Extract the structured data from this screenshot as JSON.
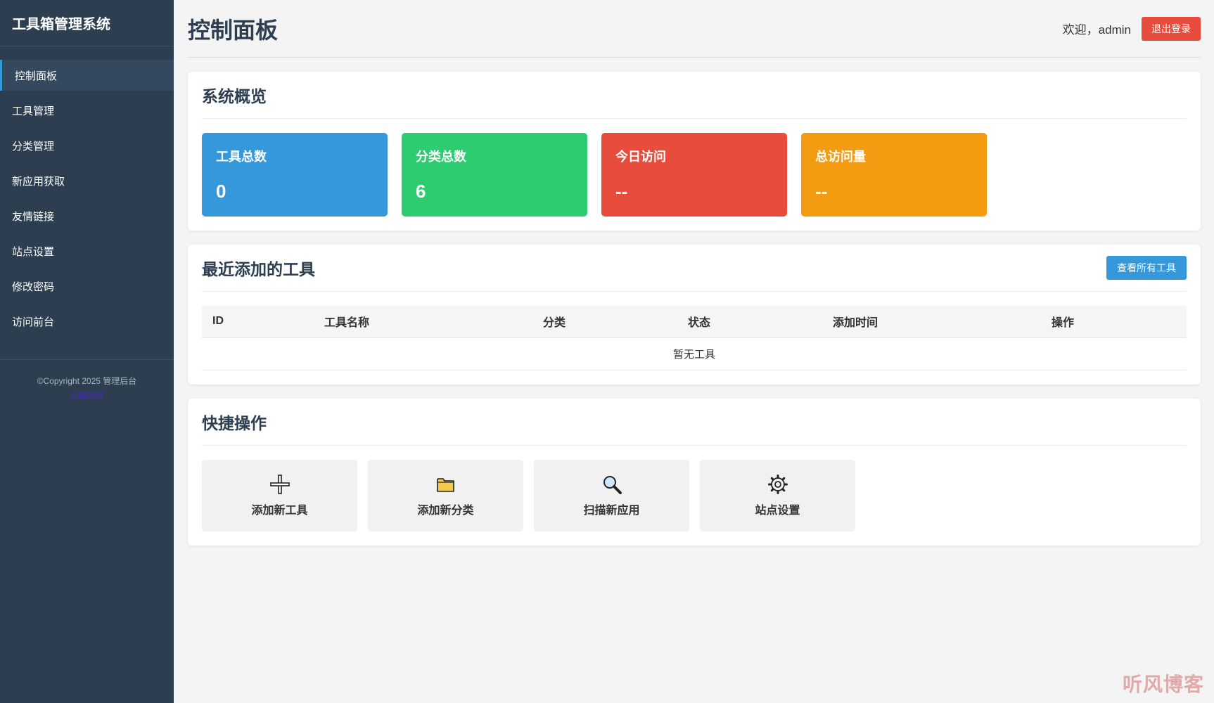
{
  "sidebar": {
    "brand": "工具箱管理系统",
    "items": [
      {
        "label": "控制面板"
      },
      {
        "label": "工具管理"
      },
      {
        "label": "分类管理"
      },
      {
        "label": "新应用获取"
      },
      {
        "label": "友情链接"
      },
      {
        "label": "站点设置"
      },
      {
        "label": "修改密码"
      },
      {
        "label": "访问前台"
      }
    ],
    "footer": {
      "copyright": "©Copyright 2025 管理后台",
      "link": "云猫网络"
    }
  },
  "header": {
    "title": "控制面板",
    "welcome": "欢迎，admin",
    "logout_label": "退出登录"
  },
  "overview": {
    "title": "系统概览",
    "stats": [
      {
        "label": "工具总数",
        "value": "0",
        "color": "#3498db"
      },
      {
        "label": "分类总数",
        "value": "6",
        "color": "#2ecc71"
      },
      {
        "label": "今日访问",
        "value": "--",
        "color": "#e74c3c"
      },
      {
        "label": "总访问量",
        "value": "--",
        "color": "#f39c12"
      }
    ]
  },
  "recent": {
    "title": "最近添加的工具",
    "view_all_label": "查看所有工具",
    "columns": [
      "ID",
      "工具名称",
      "分类",
      "状态",
      "添加时间",
      "操作"
    ],
    "empty_text": "暂无工具"
  },
  "quick": {
    "title": "快捷操作",
    "items": [
      {
        "label": "添加新工具",
        "icon": "plus-icon"
      },
      {
        "label": "添加新分类",
        "icon": "folder-icon"
      },
      {
        "label": "扫描新应用",
        "icon": "magnifier-icon"
      },
      {
        "label": "站点设置",
        "icon": "gear-icon"
      }
    ]
  },
  "watermark": "听风博客"
}
